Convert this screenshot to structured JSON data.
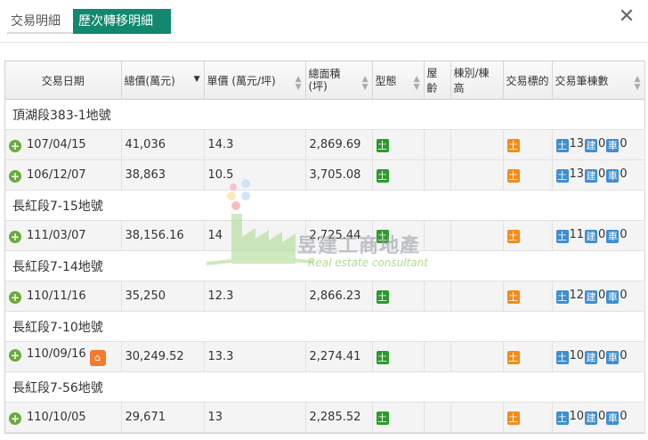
{
  "tabs": [
    {
      "label": "交易明細"
    },
    {
      "label": "歷次轉移明細"
    }
  ],
  "close_label": "✕",
  "columns": [
    {
      "label": "交易日期"
    },
    {
      "label": "總價(萬元)"
    },
    {
      "label": "單價 (萬元/坪)"
    },
    {
      "label": "總面積 (坪)"
    },
    {
      "label": "型態"
    },
    {
      "label": "屋齡"
    },
    {
      "label": "棟別/棟高"
    },
    {
      "label": "交易標的"
    },
    {
      "label": "交易筆棟數"
    }
  ],
  "groups": [
    {
      "name": "頂湖段383-1地號",
      "rows": [
        {
          "date": "107/04/15",
          "total": "41,036",
          "unit": "14.3",
          "area": "2,869.69",
          "type_icon": "土",
          "target_icon": "土",
          "land": "13",
          "build": "0",
          "car": "0"
        },
        {
          "date": "106/12/07",
          "total": "38,863",
          "unit": "10.5",
          "area": "3,705.08",
          "type_icon": "土",
          "target_icon": "土",
          "land": "13",
          "build": "0",
          "car": "0"
        }
      ]
    },
    {
      "name": "長紅段7-15地號",
      "rows": [
        {
          "date": "111/03/07",
          "total": "38,156.16",
          "unit": "14",
          "area": "2,725.44",
          "type_icon": "土",
          "target_icon": "土",
          "land": "11",
          "build": "0",
          "car": "0"
        }
      ]
    },
    {
      "name": "長紅段7-14地號",
      "rows": [
        {
          "date": "110/11/16",
          "total": "35,250",
          "unit": "12.3",
          "area": "2,866.23",
          "type_icon": "土",
          "target_icon": "土",
          "land": "12",
          "build": "0",
          "car": "0"
        }
      ]
    },
    {
      "name": "長紅段7-10地號",
      "rows": [
        {
          "date": "110/09/16",
          "total": "30,249.52",
          "unit": "13.3",
          "area": "2,274.41",
          "type_icon": "土",
          "target_icon": "土",
          "land": "10",
          "build": "0",
          "car": "0",
          "house_icon": true
        }
      ]
    },
    {
      "name": "長紅段7-56地號",
      "rows": [
        {
          "date": "110/10/05",
          "total": "29,671",
          "unit": "13",
          "area": "2,285.52",
          "type_icon": "土",
          "target_icon": "土",
          "land": "10",
          "build": "0",
          "car": "0"
        }
      ]
    }
  ],
  "badge_labels": {
    "land": "土",
    "build": "建",
    "car": "車"
  },
  "watermark": {
    "cn": "昱建工商地產",
    "en": "Real estate consultant"
  },
  "colors": {
    "tab_active": "#12886e",
    "badge_green": "#2c9a2c",
    "badge_orange": "#f08c1c",
    "badge_blue": "#3e8ed0"
  }
}
